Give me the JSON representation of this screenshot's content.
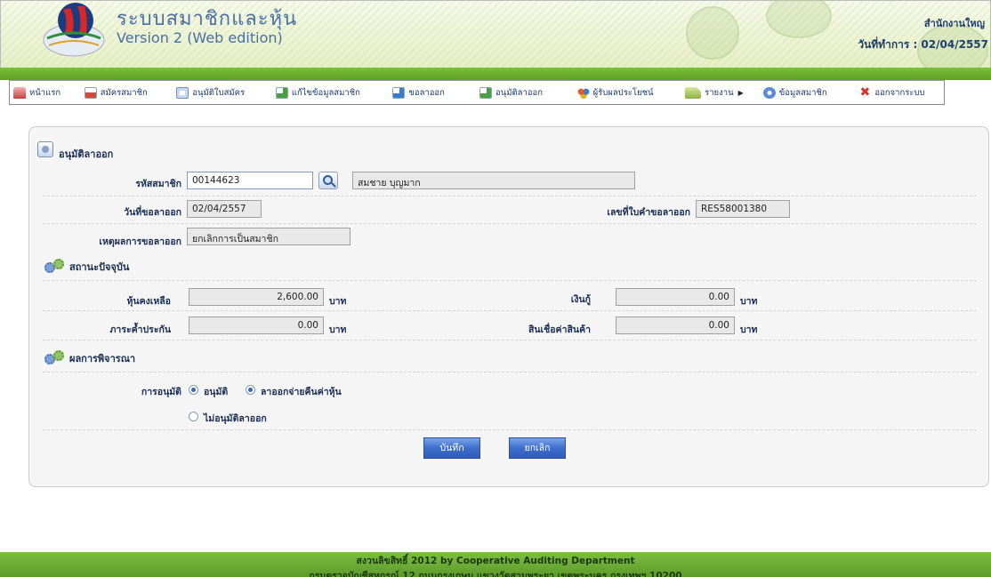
{
  "header": {
    "app_title": "ระบบสมาชิกและหุ้น",
    "app_version": "Version 2 (Web edition)",
    "org_name": "สำนักงานใหญ",
    "work_date": "วันที่ทำการ : 02/04/2557"
  },
  "menu": {
    "items": [
      {
        "label": "หน้าแรก",
        "icon": "home-icon"
      },
      {
        "label": "สมัครสมาชิก",
        "icon": "register-icon"
      },
      {
        "label": "อนุมัติใบสมัคร",
        "icon": "approve-application-icon"
      },
      {
        "label": "แก้ไขข้อมูลสมาชิก",
        "icon": "edit-member-icon"
      },
      {
        "label": "ขอลาออก",
        "icon": "resign-request-icon"
      },
      {
        "label": "อนุมัติลาออก",
        "icon": "approve-resign-icon"
      },
      {
        "label": "ผู้รับผลประโยชน์",
        "icon": "beneficiary-icon"
      },
      {
        "label": "รายงาน",
        "icon": "report-icon"
      },
      {
        "label": "ข้อมูลสมาชิก",
        "icon": "member-info-icon"
      },
      {
        "label": "ออกจากระบบ",
        "icon": "logout-icon"
      }
    ]
  },
  "form": {
    "title": "อนุมัติลาออก",
    "member_id_label": "รหัสสมาชิก",
    "member_id_value": "00144623",
    "member_name": "สมชาย บุญมาก",
    "request_date_label": "วันที่ขอลาออก",
    "request_date_value": "02/04/2557",
    "request_no_label": "เลขที่ใบคำขอลาออก",
    "request_no_value": "RES58001380",
    "reason_label": "เหตุผลการขอลาออก",
    "reason_value": "ยกเลิกการเป็นสมาชิก"
  },
  "status": {
    "title": "สถานะปัจจุบัน",
    "shares_label": "หุ้นคงเหลือ",
    "shares_value": "2,600.00",
    "loan_label": "เงินกู้",
    "loan_value": "0.00",
    "guarantee_label": "ภาระค้ำประกัน",
    "guarantee_value": "0.00",
    "credit_label": "สินเชื่อค่าสินค้า",
    "credit_value": "0.00",
    "unit": "บาท"
  },
  "decision": {
    "title": "ผลการพิจารณา",
    "approval_label": "การอนุมัติ",
    "option_approve": "อนุมัติ",
    "option_refund": "ลาออกจ่ายคืนค่าหุ้น",
    "option_reject": "ไม่อนุมัติลาออก",
    "approve_selected": true,
    "refund_selected": true,
    "reject_selected": false
  },
  "actions": {
    "save_label": "บันทึก",
    "cancel_label": "ยกเลิก"
  },
  "footer": {
    "line1": "สงวนลิขสิทธิ์ 2012 by Cooperative Auditing Department",
    "line2": "กรมตรวจบัญชีสหกรณ์ 12 ถนนกรุงเกษม แขวงวัดสามพระยา เขตพระนคร กรุงเทพฯ 10200"
  },
  "colors": {
    "brand_green": "#6aab30",
    "title_blue": "#4a6fa5",
    "label_navy": "#1a2e55",
    "button_blue": "#3e6fce"
  }
}
